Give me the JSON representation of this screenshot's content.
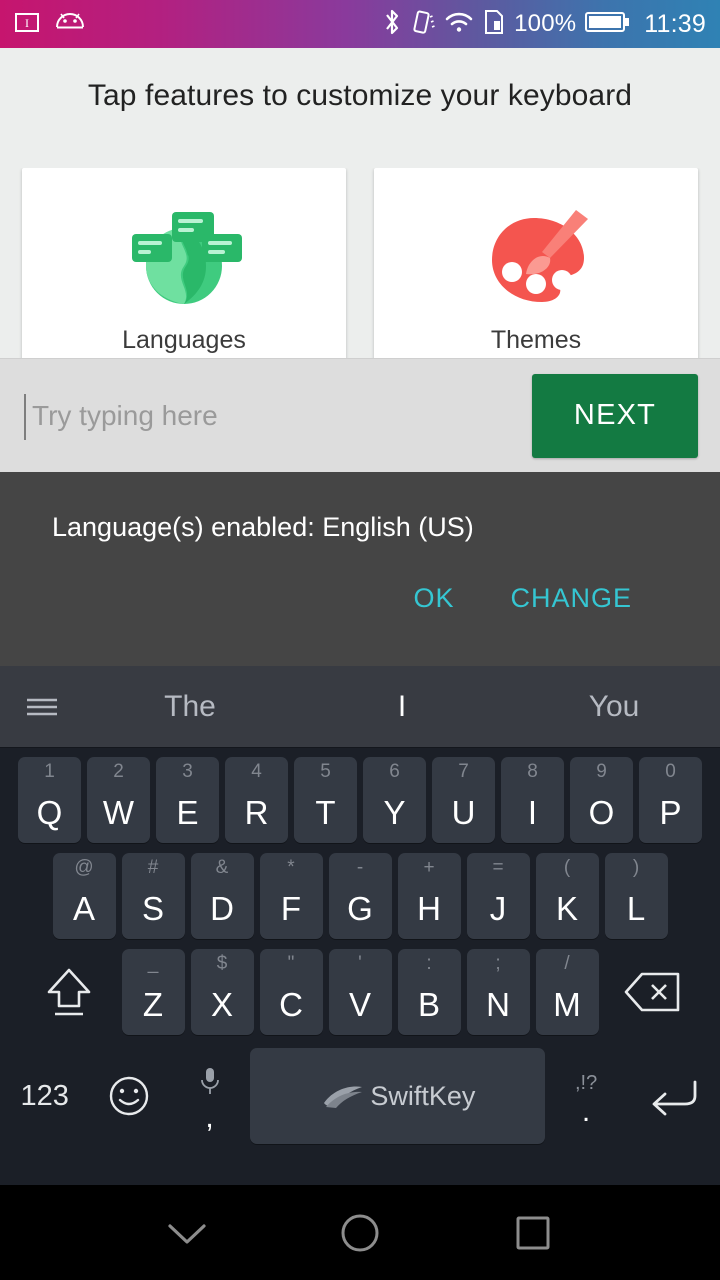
{
  "status_bar": {
    "left_icons": [
      "ime-indicator-icon",
      "android-robot-icon"
    ],
    "right_icons": [
      "bluetooth-icon",
      "vibrate-icon",
      "wifi-icon",
      "sim-card-icon"
    ],
    "battery_percent": "100%",
    "battery_icon": "battery-full-icon",
    "clock": "11:39",
    "gradient_start": "#c6156e",
    "gradient_end": "#2f82b4"
  },
  "headline": "Tap features to customize your keyboard",
  "cards": [
    {
      "label": "Languages",
      "icon": "languages-globe-icon",
      "color": "#2ec06a"
    },
    {
      "label": "Themes",
      "icon": "themes-palette-icon",
      "color": "#f4554f"
    }
  ],
  "input_row": {
    "placeholder": "Try typing here",
    "value": "",
    "next_label": "NEXT",
    "next_color": "#137a42"
  },
  "snackbar": {
    "message": "Language(s) enabled: English (US)",
    "actions": [
      "OK",
      "CHANGE"
    ],
    "action_color": "#35c6d2",
    "background": "#454545"
  },
  "keyboard": {
    "menu_icon": "hamburger-menu-icon",
    "predictions": [
      {
        "text": "The",
        "active": false
      },
      {
        "text": "I",
        "active": true
      },
      {
        "text": "You",
        "active": false
      }
    ],
    "row1": [
      {
        "pri": "Q",
        "sec": "1"
      },
      {
        "pri": "W",
        "sec": "2"
      },
      {
        "pri": "E",
        "sec": "3"
      },
      {
        "pri": "R",
        "sec": "4"
      },
      {
        "pri": "T",
        "sec": "5"
      },
      {
        "pri": "Y",
        "sec": "6"
      },
      {
        "pri": "U",
        "sec": "7"
      },
      {
        "pri": "I",
        "sec": "8"
      },
      {
        "pri": "O",
        "sec": "9"
      },
      {
        "pri": "P",
        "sec": "0"
      }
    ],
    "row2": [
      {
        "pri": "A",
        "sec": "@"
      },
      {
        "pri": "S",
        "sec": "#"
      },
      {
        "pri": "D",
        "sec": "&"
      },
      {
        "pri": "F",
        "sec": "*"
      },
      {
        "pri": "G",
        "sec": "-"
      },
      {
        "pri": "H",
        "sec": "+"
      },
      {
        "pri": "J",
        "sec": "="
      },
      {
        "pri": "K",
        "sec": "("
      },
      {
        "pri": "L",
        "sec": ")"
      }
    ],
    "row3": [
      {
        "pri": "Z",
        "sec": "_"
      },
      {
        "pri": "X",
        "sec": "$"
      },
      {
        "pri": "C",
        "sec": "\""
      },
      {
        "pri": "V",
        "sec": "'"
      },
      {
        "pri": "B",
        "sec": ":"
      },
      {
        "pri": "N",
        "sec": ";"
      },
      {
        "pri": "M",
        "sec": "/"
      }
    ],
    "shift_icon": "shift-arrow-icon",
    "backspace_icon": "backspace-icon",
    "row4": {
      "numbers_label": "123",
      "emoji_icon": "emoji-smiley-icon",
      "comma_sec_icon": "microphone-icon",
      "comma_pri": ",",
      "space_label": "SwiftKey",
      "space_icon": "swiftkey-logo-icon",
      "period_sec": ",!?",
      "period_pri": ".",
      "enter_icon": "enter-return-icon"
    }
  },
  "nav_bar": {
    "buttons": [
      "chevron-down-icon",
      "home-circle-icon",
      "recents-square-icon"
    ]
  }
}
